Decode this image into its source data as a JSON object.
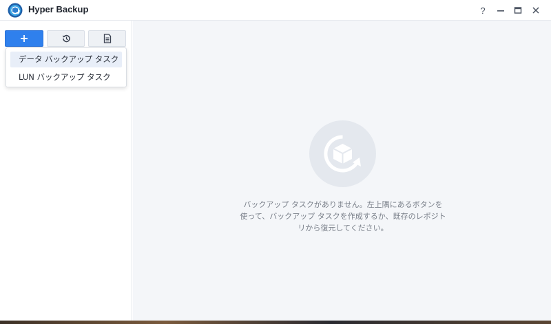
{
  "window": {
    "title": "Hyper Backup",
    "help_label": "?"
  },
  "toolbar": {
    "add_icon": "plus-icon",
    "restore_icon": "history-icon",
    "log_icon": "document-icon"
  },
  "create_menu": {
    "items": [
      {
        "label": "データ バックアップ タスク",
        "active": true
      },
      {
        "label": "LUN バックアップ タスク",
        "active": false
      }
    ]
  },
  "empty_state": {
    "icon": "backup-cube-icon",
    "message": "バックアップ タスクがありません。左上隅にあるボタンを使って、バックアップ タスクを作成するか、既存のレポジトリから復元してください。"
  },
  "colors": {
    "accent": "#2f80ed",
    "sidebar_bg": "#ffffff",
    "main_bg": "#f4f6f9",
    "illus_bg": "#e4e8ee"
  }
}
